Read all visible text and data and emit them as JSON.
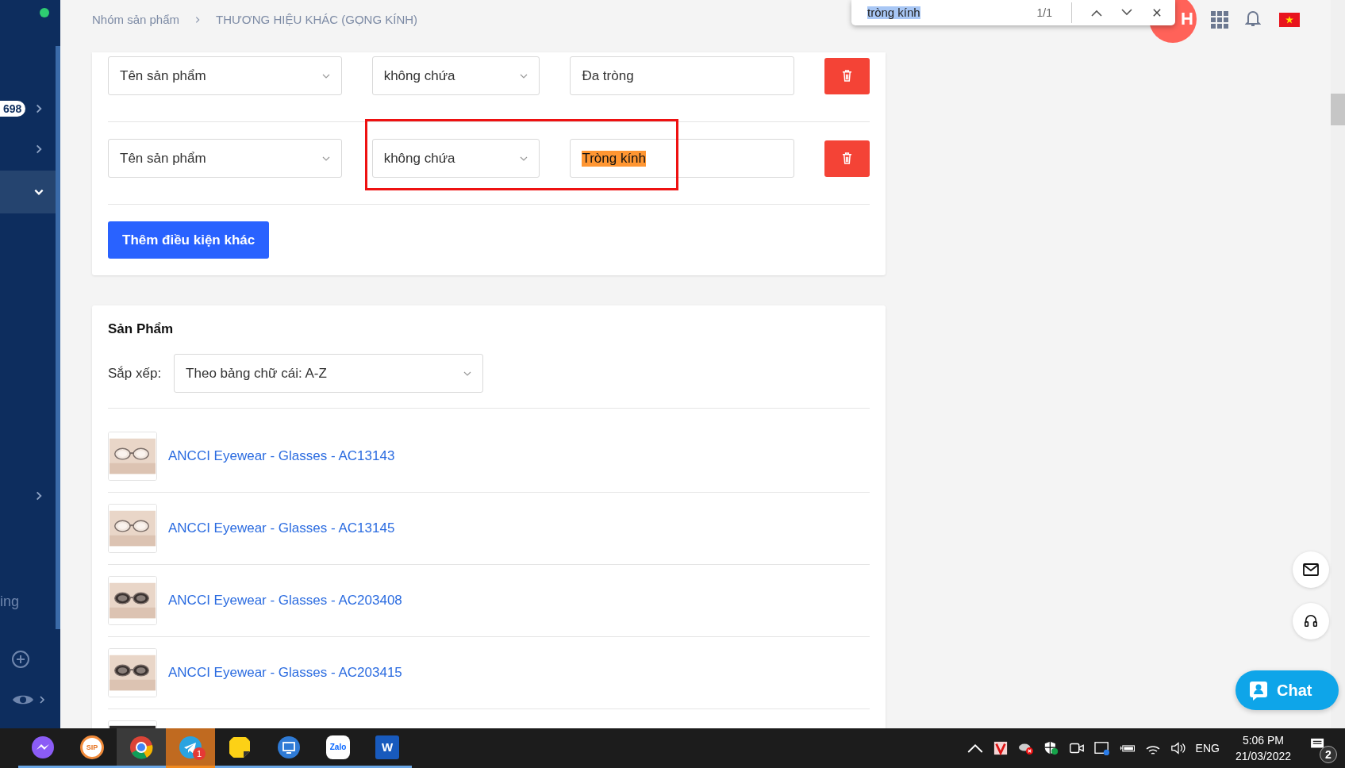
{
  "sidebar": {
    "items": [
      {
        "badge": "698",
        "expanded": false,
        "selected": false
      },
      {
        "expanded": false,
        "selected": false
      },
      {
        "expanded": true,
        "selected": true
      },
      {
        "expanded": false,
        "selected": false
      }
    ],
    "label_fragment": "ing"
  },
  "breadcrumb": [
    "Nhóm sản phẩm",
    "THƯƠNG HIỆU KHÁC (GỌNG KÍNH)"
  ],
  "find_bar": {
    "query": "tròng kính",
    "count": "1/1"
  },
  "avatar": {
    "initial": "H"
  },
  "conditions": [
    {
      "field": "Tên sản phẩm",
      "operator": "không chứa",
      "value": "Đa tròng",
      "highlighted": false
    },
    {
      "field": "Tên sản phẩm",
      "operator": "không chứa",
      "value": "Tròng kính",
      "highlighted": true
    }
  ],
  "add_condition_button": "Thêm điều kiện khác",
  "products": {
    "title": "Sản Phẩm",
    "sort_label": "Sắp xếp:",
    "sort_value": "Theo bảng chữ cái: A-Z",
    "items": [
      {
        "name": "ANCCI Eyewear - Glasses - AC13143"
      },
      {
        "name": "ANCCI Eyewear - Glasses - AC13145"
      },
      {
        "name": "ANCCI Eyewear - Glasses - AC203408"
      },
      {
        "name": "ANCCI Eyewear - Glasses - AC203415"
      }
    ]
  },
  "chat_button": "Chat",
  "taskbar": {
    "apps": [
      {
        "kind": "messenger",
        "active": false,
        "flashing": false
      },
      {
        "kind": "sip",
        "label": "SIP",
        "active": false,
        "flashing": false
      },
      {
        "kind": "chrome",
        "active": true,
        "flashing": false
      },
      {
        "kind": "telegram",
        "badge": "1",
        "active": false,
        "flashing": true
      },
      {
        "kind": "notes",
        "active": false,
        "flashing": false
      },
      {
        "kind": "remote",
        "active": false,
        "flashing": false
      },
      {
        "kind": "zalo",
        "label": "Zalo",
        "active": false,
        "flashing": false
      },
      {
        "kind": "word",
        "label": "W",
        "active": false,
        "flashing": false
      }
    ],
    "language": "ENG",
    "time": "5:06 PM",
    "date": "21/03/2022",
    "notifications": "2"
  }
}
